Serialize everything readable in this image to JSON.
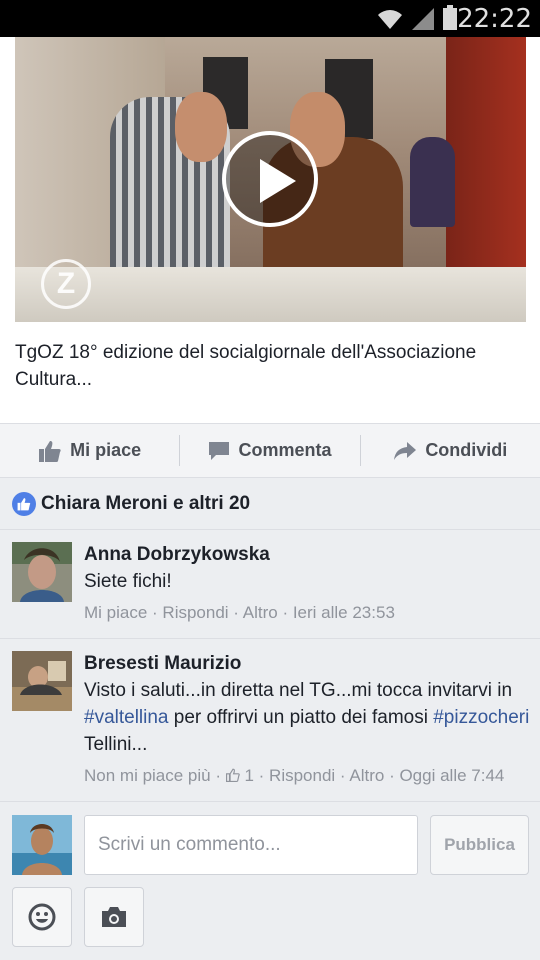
{
  "status_bar": {
    "time": "22:22"
  },
  "post": {
    "title": "TgOZ 18° edizione del socialgiornale dell'Associazione Cultura...",
    "video_logo": "Z"
  },
  "actions": {
    "like": "Mi piace",
    "comment": "Commenta",
    "share": "Condividi"
  },
  "likes": {
    "text": "Chiara Meroni e altri 20"
  },
  "comments": [
    {
      "name": "Anna Dobrzykowska",
      "text": "Siete fichi!",
      "like": "Mi piace",
      "reply": "Rispondi",
      "more": "Altro",
      "time": "Ieri alle 23:53"
    },
    {
      "name": "Bresesti Maurizio",
      "text_1": "Visto i saluti...in diretta nel TG...mi tocca invitarvi in ",
      "hashtag_1": "#valtellina",
      "text_2": " per offrirvi un piatto dei famosi ",
      "hashtag_2": "#pizzocheri",
      "text_3": " Tellini...",
      "unlike": "Non mi piace più",
      "like_count": "1",
      "reply": "Rispondi",
      "more": "Altro",
      "time": "Oggi alle 7:44"
    }
  ],
  "composer": {
    "placeholder": "Scrivi un commento...",
    "publish": "Pubblica"
  },
  "colors": {
    "accent": "#4f7fe6",
    "link": "#365899",
    "meta": "#90949c"
  }
}
